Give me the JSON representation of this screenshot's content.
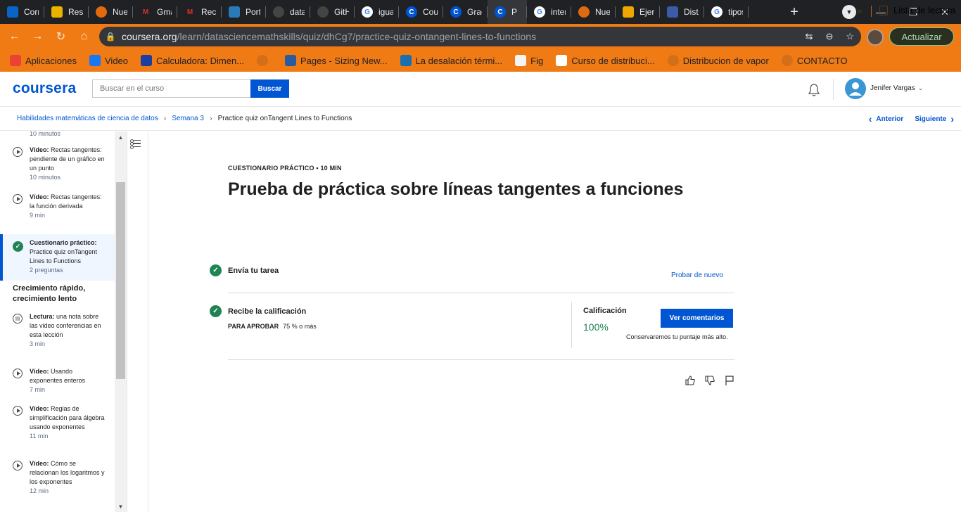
{
  "browser": {
    "tabs": [
      {
        "label": "Corr",
        "icon": "outlook-icon",
        "color": "#0a64c8"
      },
      {
        "label": "Resu",
        "icon": "resume-icon",
        "color": "#e8b400"
      },
      {
        "label": "Nue",
        "icon": "firefox-icon",
        "color": "#e06a10"
      },
      {
        "label": "Gma",
        "icon": "gmail-icon",
        "color": "#d93025"
      },
      {
        "label": "Recil",
        "icon": "gmail-icon",
        "color": "#d93025"
      },
      {
        "label": "Porta",
        "icon": "portal-icon",
        "color": "#2a7ab8"
      },
      {
        "label": "data",
        "icon": "github-icon",
        "color": "#444"
      },
      {
        "label": "GitH",
        "icon": "github-icon",
        "color": "#444"
      },
      {
        "label": "igual",
        "icon": "google-icon",
        "color": "#fff"
      },
      {
        "label": "Cour",
        "icon": "coursera-icon",
        "color": "#0056d2"
      },
      {
        "label": "Grac",
        "icon": "coursera-icon",
        "color": "#0056d2"
      },
      {
        "label": "P",
        "icon": "coursera-icon",
        "color": "#0056d2",
        "active": true
      },
      {
        "label": "inter",
        "icon": "google-icon",
        "color": "#fff"
      },
      {
        "label": "Nue",
        "icon": "firefox-icon",
        "color": "#e06a10"
      },
      {
        "label": "Ejerc",
        "icon": "sheet-icon",
        "color": "#f0a500"
      },
      {
        "label": "Dista",
        "icon": "doc-icon",
        "color": "#3c5aa8"
      },
      {
        "label": "tipos",
        "icon": "google-icon",
        "color": "#fff"
      }
    ],
    "url_host": "coursera.org",
    "url_path": "/learn/datasciencemathskills/quiz/dhCg7/practice-quiz-ontangent-lines-to-functions",
    "update_label": "Actualizar",
    "bookmarks": [
      {
        "label": "Aplicaciones",
        "icon": "apps-icon",
        "color": "#ea4335"
      },
      {
        "label": "Video",
        "icon": "facebook-icon",
        "color": "#1877f2"
      },
      {
        "label": "Calculadora: Dimen...",
        "icon": "tlv-icon",
        "color": "#1a3fa0"
      },
      {
        "label": "",
        "icon": "globe-icon",
        "color": "#d36f18"
      },
      {
        "label": "Pages - Sizing New...",
        "icon": "pages-icon",
        "color": "#2a5aa0"
      },
      {
        "label": "La desalación térmi...",
        "icon": "gear-icon",
        "color": "#1a6fb0"
      },
      {
        "label": "Fig",
        "icon": "fig-icon",
        "color": "#f4f4f4"
      },
      {
        "label": "Curso de distribuci...",
        "icon": "course-icon",
        "color": "#ffffff"
      },
      {
        "label": "Distribucion de vapor",
        "icon": "globe-icon",
        "color": "#d36f18"
      },
      {
        "label": "CONTACTO",
        "icon": "globe-icon",
        "color": "#d36f18"
      }
    ],
    "more": "»",
    "reading_list": "Lista de lectura"
  },
  "header": {
    "logo": "coursera",
    "search_placeholder": "Buscar en el curso",
    "search_button": "Buscar",
    "user_name": "Jenifer Vargas"
  },
  "breadcrumb": {
    "items": [
      "Habilidades matemáticas de ciencia de datos",
      "Semana 3",
      "Practice quiz onTangent Lines to Functions"
    ],
    "prev": "Anterior",
    "next": "Siguiente"
  },
  "sidebar": {
    "top_duration": "10 minutos",
    "items": [
      {
        "kind": "Vídeo:",
        "title": "Rectas tangentes: pendiente de un gráfico en un punto",
        "duration": "10 minutos"
      },
      {
        "kind": "Vídeo:",
        "title": "Rectas tangentes: la función derivada",
        "duration": "9 min"
      },
      {
        "kind": "Cuestionario práctico:",
        "title": "Practice quiz onTangent Lines to Functions",
        "duration": "2 preguntas"
      },
      {
        "kind": "Lectura:",
        "title": "una nota sobre las video conferencias en esta lección",
        "duration": "3 min"
      },
      {
        "kind": "Vídeo:",
        "title": "Usando exponentes enteros",
        "duration": "7 min"
      },
      {
        "kind": "Vídeo:",
        "title": "Reglas de simplificación para álgebra usando exponentes",
        "duration": "11 min"
      },
      {
        "kind": "Vídeo:",
        "title": "Cómo se relacionan los logaritmos y los exponentes",
        "duration": "12 min"
      }
    ],
    "section_title": "Crecimiento rápido, crecimiento lento"
  },
  "main": {
    "kicker": "CUESTIONARIO PRÁCTICO •  10 MIN",
    "title": "Prueba de práctica sobre líneas tangentes a funciones",
    "step1": "Envía tu tarea",
    "retry": "Probar de nuevo",
    "step2": "Recibe la calificación",
    "pass_label": "PARA APROBAR",
    "pass_value": "75 % o más",
    "grade_label": "Calificación",
    "grade_value": "100%",
    "feedback_button": "Ver comentarios",
    "keep_note": "Conservaremos tu puntaje más alto."
  }
}
